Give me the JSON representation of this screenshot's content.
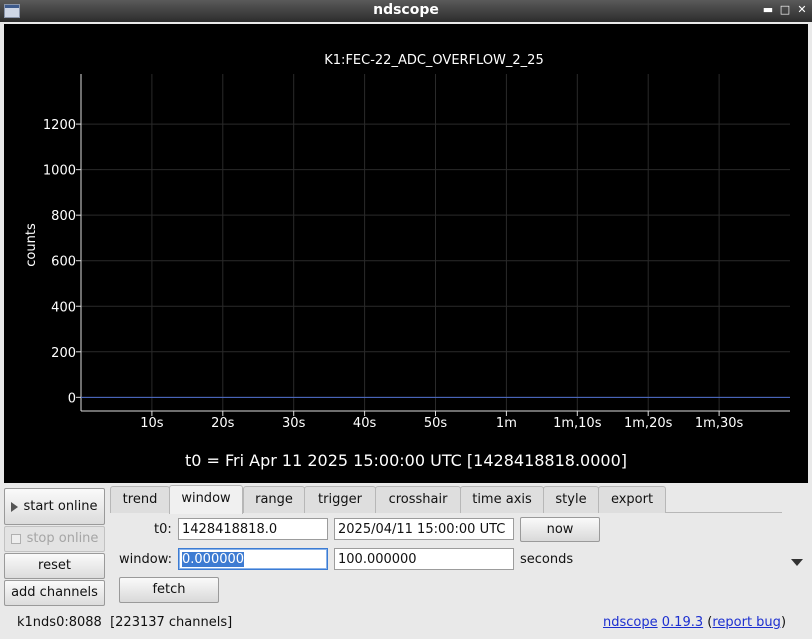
{
  "window": {
    "title": "ndscope"
  },
  "plot": {
    "t0_label": "t0 = Fri Apr 11 2025 15:00:00 UTC [1428418818.0000]"
  },
  "chart_data": {
    "type": "line",
    "title": "K1:FEC-22_ADC_OVERFLOW_2_25",
    "xlabel": "",
    "ylabel": "counts",
    "x_tick_labels": [
      "10s",
      "20s",
      "30s",
      "40s",
      "50s",
      "1m",
      "1m,10s",
      "1m,20s",
      "1m,30s"
    ],
    "x_ticks_seconds": [
      10,
      20,
      30,
      40,
      50,
      60,
      70,
      80,
      90
    ],
    "xlim": [
      0,
      100
    ],
    "y_ticks": [
      0,
      200,
      400,
      600,
      800,
      1000,
      1200
    ],
    "ylim": [
      -60,
      1420
    ],
    "grid": true,
    "series": [
      {
        "color": "#4f6fcf",
        "x": [
          0,
          100
        ],
        "y": [
          0,
          0
        ]
      }
    ]
  },
  "sidebar": {
    "start_online": "start online",
    "stop_online": "stop online",
    "reset": "reset",
    "add_channels": "add channels"
  },
  "tabs": [
    "trend",
    "window",
    "range",
    "trigger",
    "crosshair",
    "time axis",
    "style",
    "export"
  ],
  "window_tab": {
    "t0_label": "t0:",
    "t0_gps": "1428418818.0",
    "t0_utc": "2025/04/11 15:00:00 UTC",
    "now": "now",
    "window_label": "window:",
    "window_start": "0.000000",
    "window_end": "100.000000",
    "seconds": "seconds",
    "fetch": "fetch"
  },
  "status": {
    "server": "k1nds0:8088",
    "channels": "[223137 channels]",
    "app_link": "ndscope",
    "version": "0.19.3",
    "open_paren": "(",
    "report_bug": "report bug",
    "close_paren": ")"
  },
  "colors": {
    "plot_background": "#000000",
    "trace": "#4f6fcf",
    "selection": "#3d7bd2",
    "link": "#1c2fd0"
  }
}
